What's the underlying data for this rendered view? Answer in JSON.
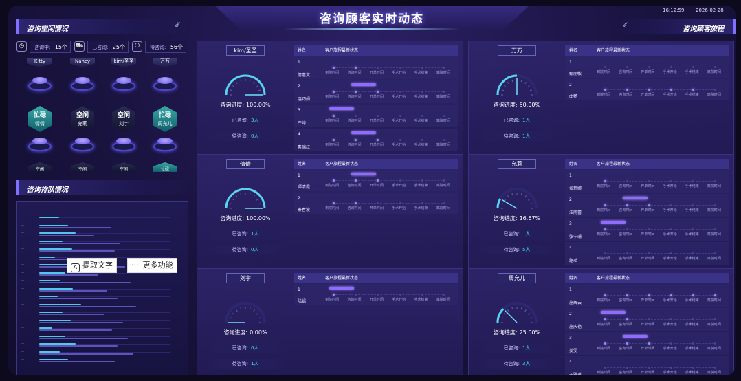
{
  "header": {
    "title": "咨询顾客实时动态",
    "time": "16:12:59",
    "date": "2026-02-28"
  },
  "left": {
    "section1_title": "咨询空闲情况",
    "stats": [
      {
        "icon": "clock-icon",
        "glyph": "◷",
        "label": "咨询中:",
        "value": "15个"
      },
      {
        "icon": "car-icon",
        "glyph": "⛟",
        "label": "已咨询:",
        "value": "25个"
      },
      {
        "icon": "power-icon",
        "glyph": "⏻",
        "label": "待咨询:",
        "value": "56个"
      }
    ],
    "top_row": [
      "Kitty",
      "Nancy",
      "kim/圣圣",
      "万万"
    ],
    "hexes": [
      {
        "status": "忙碌",
        "name": "倩倩",
        "busy": true
      },
      {
        "status": "空闲",
        "name": "允莉",
        "busy": false
      },
      {
        "status": "空闲",
        "name": "刘宇",
        "busy": false
      },
      {
        "status": "忙碌",
        "name": "周允儿",
        "busy": true
      }
    ],
    "bottom_row": [
      "空闲",
      "空闲",
      "空闲",
      "忙碌"
    ],
    "section2_title": "咨询排队情况",
    "legend": [
      "—",
      "—"
    ]
  },
  "right_header": "咨询顾客旅程",
  "overlay": {
    "extract_label": "提取文字",
    "more_label": "更多功能"
  },
  "table_headers": {
    "name": "姓名",
    "status": "客户旅程最新状态"
  },
  "stages": [
    "到院时间",
    "咨询时间",
    "开单时间",
    "手术开始",
    "手术结束",
    "离院时间"
  ],
  "labels": {
    "progress": "咨询进度:",
    "done": "已咨询:",
    "waiting": "待咨询:"
  },
  "consultants": [
    {
      "name": "kim/圣圣",
      "progress": "100.00%",
      "pct": 100,
      "done": "3人",
      "waiting": "0人",
      "customers": [
        {
          "num": "1",
          "name": "倩惠文",
          "reached": 2,
          "pill": false
        },
        {
          "num": "2",
          "name": "温巧娟",
          "reached": 3,
          "pill": true
        },
        {
          "num": "3",
          "name": "严婷",
          "reached": 1,
          "pill": true
        },
        {
          "num": "4",
          "name": "素瑞红",
          "reached": 3,
          "pill": true
        }
      ]
    },
    {
      "name": "万万",
      "progress": "50.00%",
      "pct": 50,
      "done": "1人",
      "waiting": "1人",
      "customers": [
        {
          "num": "1",
          "name": "甄丽敏",
          "reached": 0,
          "pill": false
        },
        {
          "num": "2",
          "name": "曲畅",
          "reached": 5,
          "pill": false
        }
      ]
    },
    {
      "name": "倩倩",
      "progress": "100.00%",
      "pct": 100,
      "done": "1人",
      "waiting": "0人",
      "customers": [
        {
          "num": "1",
          "name": "谭清霞",
          "reached": 3,
          "pill": true
        },
        {
          "num": "2",
          "name": "秦春波",
          "reached": 2,
          "pill": false
        }
      ]
    },
    {
      "name": "允莉",
      "progress": "16.67%",
      "pct": 16.67,
      "done": "1人",
      "waiting": "5人",
      "customers": [
        {
          "num": "1",
          "name": "张玮娜",
          "reached": 1,
          "pill": false
        },
        {
          "num": "2",
          "name": "汪雨蕾",
          "reached": 3,
          "pill": true
        },
        {
          "num": "3",
          "name": "张宁珊",
          "reached": 1,
          "pill": true
        },
        {
          "num": "4",
          "name": "路瑶",
          "reached": 0,
          "pill": false
        }
      ]
    },
    {
      "name": "刘宇",
      "progress": "0.00%",
      "pct": 0,
      "done": "0人",
      "waiting": "1人",
      "customers": [
        {
          "num": "1",
          "name": "陆娟",
          "reached": 1,
          "pill": true
        }
      ]
    },
    {
      "name": "周允儿",
      "progress": "25.00%",
      "pct": 25,
      "done": "1人",
      "waiting": "3人",
      "customers": [
        {
          "num": "1",
          "name": "施辉云",
          "reached": 6,
          "pill": false
        },
        {
          "num": "2",
          "name": "施庆艳",
          "reached": 2,
          "pill": true
        },
        {
          "num": "3",
          "name": "姜雯",
          "reached": 3,
          "pill": true
        },
        {
          "num": "4",
          "name": "于雅琪",
          "reached": 0,
          "pill": false
        }
      ]
    }
  ],
  "rank_rows": [
    {
      "label": "—",
      "a": 0.15,
      "b": 0.0
    },
    {
      "label": "—",
      "a": 0.22,
      "b": 0.55
    },
    {
      "label": "—",
      "a": 0.28,
      "b": 0.42
    },
    {
      "label": "—",
      "a": 0.18,
      "b": 0.62
    },
    {
      "label": "—",
      "a": 0.25,
      "b": 0.58
    },
    {
      "label": "—",
      "a": 0.12,
      "b": 0.48
    },
    {
      "label": "—",
      "a": 0.3,
      "b": 0.66
    },
    {
      "label": "—",
      "a": 0.2,
      "b": 0.45
    },
    {
      "label": "—",
      "a": 0.16,
      "b": 0.7
    },
    {
      "label": "—",
      "a": 0.26,
      "b": 0.52
    },
    {
      "label": "—",
      "a": 0.14,
      "b": 0.6
    },
    {
      "label": "—",
      "a": 0.32,
      "b": 0.74
    },
    {
      "label": "—",
      "a": 0.18,
      "b": 0.5
    },
    {
      "label": "—",
      "a": 0.24,
      "b": 0.64
    },
    {
      "label": "—",
      "a": 0.1,
      "b": 0.56
    },
    {
      "label": "—",
      "a": 0.2,
      "b": 0.68
    },
    {
      "label": "—",
      "a": 0.28,
      "b": 0.6
    },
    {
      "label": "—",
      "a": 0.16,
      "b": 0.72
    },
    {
      "label": "—",
      "a": 0.22,
      "b": 0.58
    }
  ]
}
